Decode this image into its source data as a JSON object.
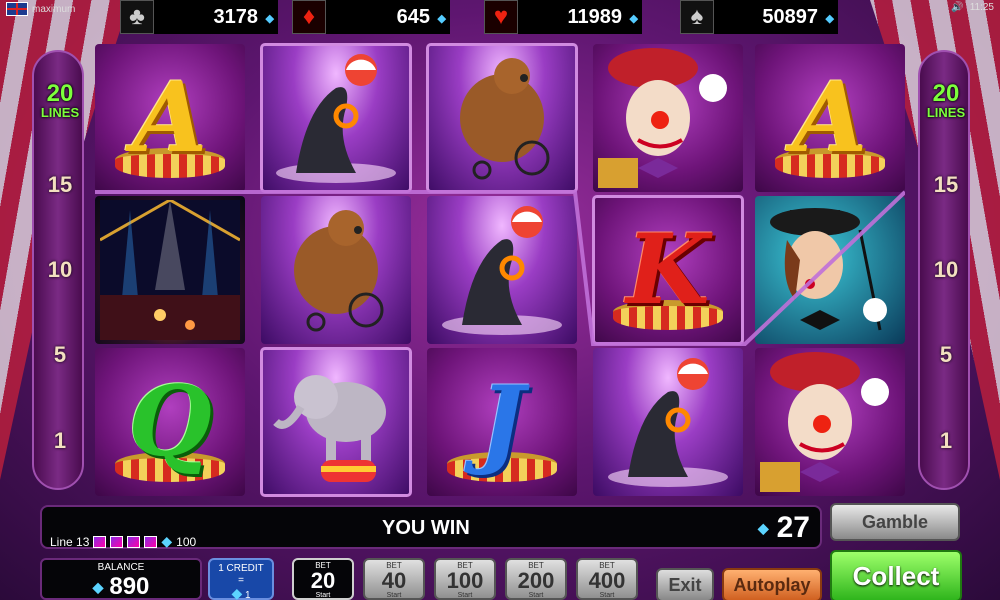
{
  "top_bar": {
    "left_corner_text": "maximum",
    "right_corner_time": "11:25",
    "jackpots": [
      {
        "suit": "clubs",
        "symbol": "♣",
        "value": "3178",
        "color": "black"
      },
      {
        "suit": "diamonds",
        "symbol": "♦",
        "value": "645",
        "color": "red"
      },
      {
        "suit": "hearts",
        "symbol": "♥",
        "value": "11989",
        "color": "red"
      },
      {
        "suit": "spades",
        "symbol": "♠",
        "value": "50897",
        "color": "black"
      }
    ]
  },
  "lines_panel": {
    "lines_count": "20",
    "lines_label": "LINES",
    "markers": [
      "15",
      "10",
      "5",
      "1"
    ]
  },
  "reels": [
    [
      "A",
      "circus-scene",
      "Q"
    ],
    [
      "seal",
      "bear",
      "elephant"
    ],
    [
      "bear",
      "seal",
      "J"
    ],
    [
      "clown",
      "K",
      "seal"
    ],
    [
      "A",
      "ringmaster-woman",
      "clown"
    ]
  ],
  "info_bar": {
    "line_text": "Line 13",
    "line_win": "100",
    "win_text": "YOU WIN",
    "win_amount": "27"
  },
  "controls": {
    "gamble_label": "Gamble",
    "collect_label": "Collect",
    "balance_label": "BALANCE",
    "balance_value": "890",
    "credit_label": "1 CREDIT",
    "credit_eq": "=",
    "credit_value": "1",
    "bet_label": "BET",
    "bet_sub": "Start",
    "bets": [
      "20",
      "40",
      "100",
      "200",
      "400"
    ],
    "active_bet": "20",
    "exit_label": "Exit",
    "autoplay_label": "Autoplay"
  },
  "colors": {
    "lines_badge": "#7dff3c",
    "collect": "#2fb51c",
    "autoplay": "#d06020",
    "diamond_gem": "#5cd4ff"
  }
}
